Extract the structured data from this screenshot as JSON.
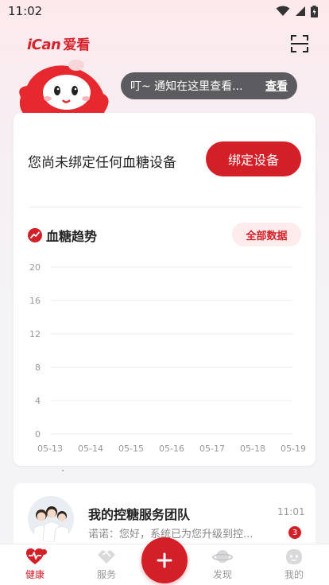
{
  "status_bar": {
    "time": "11:02"
  },
  "header": {
    "logo_en": "iCan",
    "logo_cn": "爱看"
  },
  "notice": {
    "text": "叮~ 通知在这里查看...",
    "link": "查看"
  },
  "device": {
    "message": "您尚未绑定任何血糖设备",
    "bind_label": "绑定设备"
  },
  "trend": {
    "title": "血糖趋势",
    "all_data_label": "全部数据"
  },
  "chart_data": {
    "type": "line",
    "categories": [
      "05-13",
      "05-14",
      "05-15",
      "05-16",
      "05-17",
      "05-18",
      "05-19"
    ],
    "series": [],
    "yticks": [
      0,
      4,
      8,
      12,
      16,
      20
    ],
    "ylim": [
      0,
      20
    ],
    "grid": true
  },
  "team": {
    "name": "我的控糖服务团队",
    "time": "11:01",
    "message": "诺诺：您好，系统已为您升级到控...",
    "unread": "3"
  },
  "tabs": [
    {
      "label": "健康",
      "icon": "heart-pulse-icon",
      "active": true
    },
    {
      "label": "服务",
      "icon": "handshake-icon",
      "active": false
    },
    {
      "label": "发现",
      "icon": "planet-icon",
      "active": false
    },
    {
      "label": "我的",
      "icon": "face-icon",
      "active": false
    }
  ],
  "colors": {
    "accent": "#d31f27",
    "grid": "#ececec",
    "tick": "#999999"
  }
}
